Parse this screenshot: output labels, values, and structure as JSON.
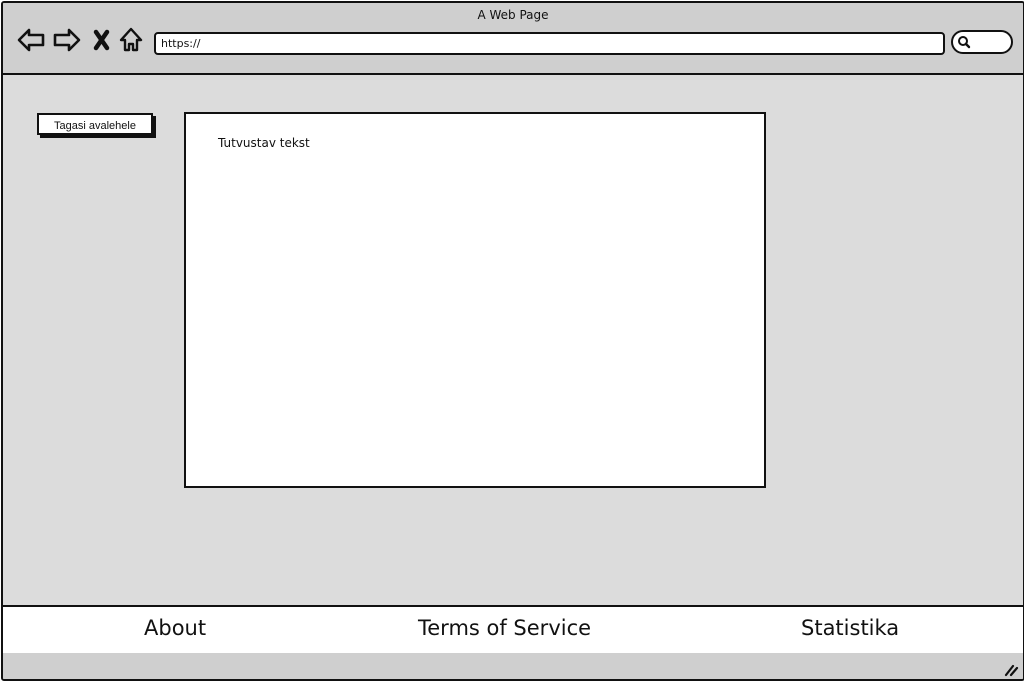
{
  "window": {
    "title": "A Web Page"
  },
  "toolbar": {
    "back_icon": "back-arrow-icon",
    "forward_icon": "forward-arrow-icon",
    "stop_icon": "close-icon",
    "home_icon": "home-icon",
    "address_value": "https://",
    "search_icon": "search-icon"
  },
  "main": {
    "back_button_label": "Tagasi avalehele",
    "content_text": "Tutvustav tekst"
  },
  "footer": {
    "links": [
      {
        "label": "About"
      },
      {
        "label": "Terms of Service"
      },
      {
        "label": "Statistika"
      }
    ]
  },
  "status_bar": {
    "grip_icon": "resize-grip-icon"
  },
  "colors": {
    "chrome": "#cfcfcf",
    "page_background": "#dcdcdc",
    "panel": "#ffffff",
    "stroke": "#111111"
  }
}
